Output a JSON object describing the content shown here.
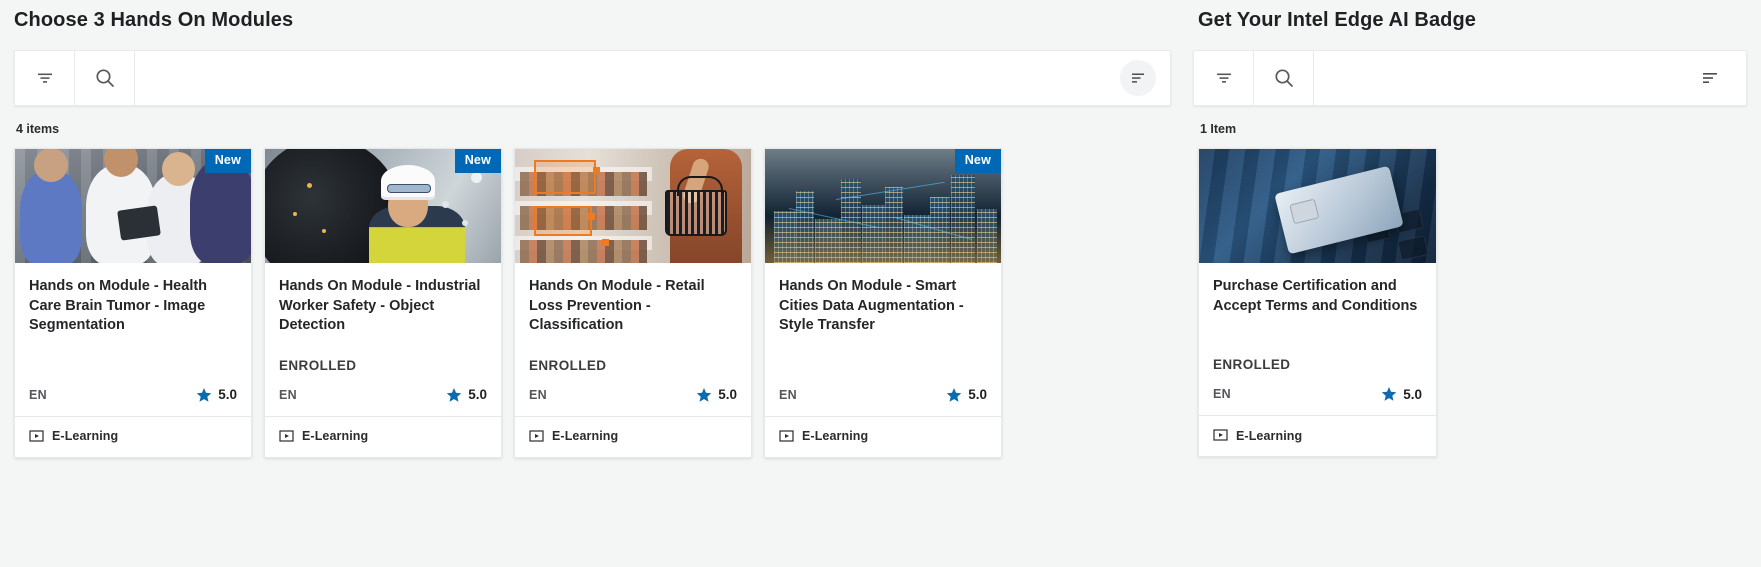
{
  "left_panel": {
    "title": "Choose 3 Hands On Modules",
    "count_label": "4 items",
    "toolbar": {
      "filter_icon": "filter-icon",
      "search_icon": "search-icon",
      "sort_icon": "sort-icon",
      "search_value": "",
      "search_placeholder": ""
    },
    "cards": [
      {
        "title": "Hands on Module - Health Care Brain Tumor - Image Segmentation",
        "badge": "New",
        "has_badge": true,
        "status": "",
        "language": "EN",
        "rating": "5.0",
        "format": "E-Learning",
        "art": "art-health"
      },
      {
        "title": "Hands On Module - Industrial Worker Safety - Object Detection",
        "badge": "New",
        "has_badge": true,
        "status": "ENROLLED",
        "language": "EN",
        "rating": "5.0",
        "format": "E-Learning",
        "art": "art-ind"
      },
      {
        "title": "Hands On Module - Retail Loss Prevention - Classification",
        "badge": "",
        "has_badge": false,
        "status": "ENROLLED",
        "language": "EN",
        "rating": "5.0",
        "format": "E-Learning",
        "art": "art-retail"
      },
      {
        "title": "Hands On Module - Smart Cities Data Augmentation - Style Transfer",
        "badge": "New",
        "has_badge": true,
        "status": "",
        "language": "EN",
        "rating": "5.0",
        "format": "E-Learning",
        "art": "art-city"
      }
    ]
  },
  "right_panel": {
    "title": "Get Your Intel Edge AI Badge",
    "count_label": "1 Item",
    "toolbar": {
      "filter_icon": "filter-icon",
      "search_icon": "search-icon",
      "sort_icon": "sort-icon",
      "search_value": "",
      "search_placeholder": ""
    },
    "cards": [
      {
        "title": "Purchase Certification and Accept Terms and Conditions",
        "badge": "",
        "has_badge": false,
        "status": "ENROLLED",
        "language": "EN",
        "rating": "5.0",
        "format": "E-Learning",
        "art": "art-badge"
      }
    ]
  },
  "colors": {
    "accent_blue": "#0068b5",
    "star_blue": "#0b6ab0",
    "page_bg": "#f4f5f5",
    "card_bg": "#ffffff",
    "text_dark": "#25262a"
  }
}
